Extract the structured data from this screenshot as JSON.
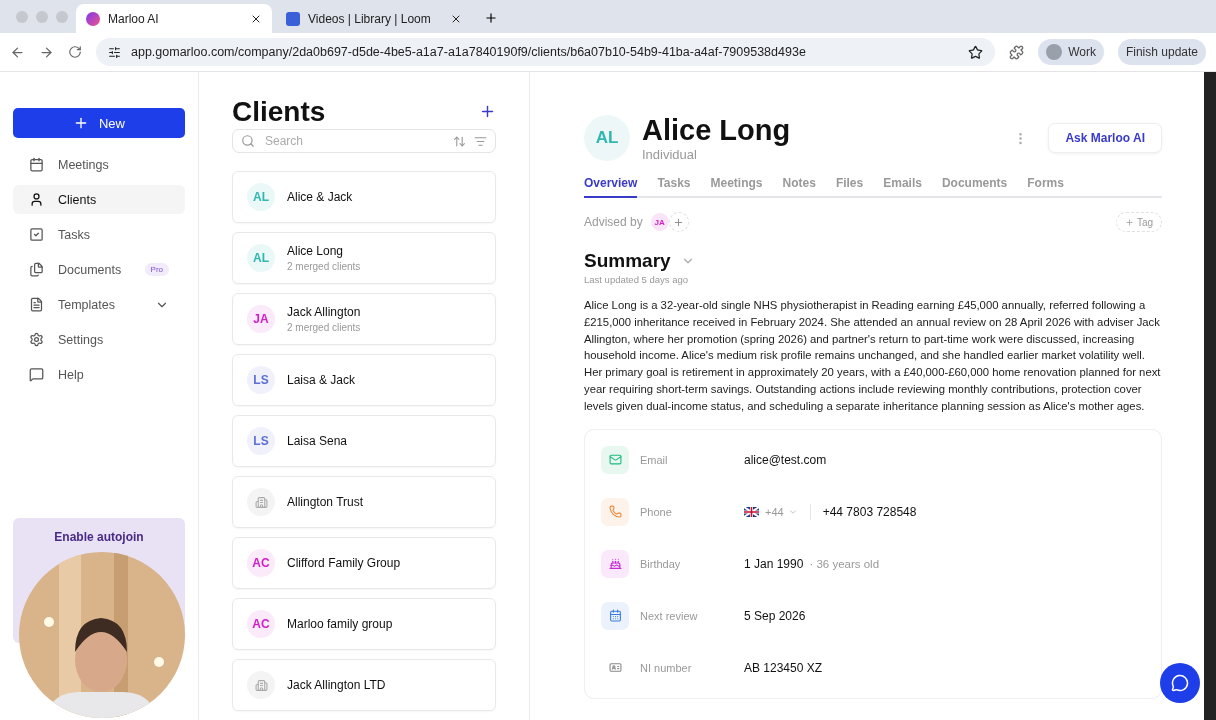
{
  "browser": {
    "tabs": [
      {
        "title": "Marloo AI",
        "selected": true,
        "kind": "marloo"
      },
      {
        "title": "Videos | Library | Loom",
        "selected": false,
        "kind": "loom"
      }
    ],
    "url": "app.gomarloo.com/company/2da0b697-d5de-4be5-a1a7-a1a7840190f9/clients/b6a07b10-54b9-41ba-a4af-7909538d493e",
    "profile": "Work",
    "update": "Finish update"
  },
  "sidebar": {
    "new_button": "New",
    "items": [
      {
        "label": "Meetings",
        "selected": false
      },
      {
        "label": "Clients",
        "selected": true
      },
      {
        "label": "Tasks",
        "selected": false
      },
      {
        "label": "Documents",
        "selected": false,
        "badge": "Pro"
      },
      {
        "label": "Templates",
        "selected": false,
        "expandable": true
      },
      {
        "label": "Settings",
        "selected": false
      },
      {
        "label": "Help",
        "selected": false
      }
    ],
    "promo": {
      "title": "Enable autojoin",
      "kind": "picture"
    }
  },
  "clients": {
    "title": "Clients",
    "search": {
      "placeholder": "Search"
    },
    "items": [
      {
        "kind": "person",
        "initials": "AL",
        "color": "#2fb7b0",
        "name": "Alice & Jack"
      },
      {
        "kind": "person",
        "initials": "AL",
        "color": "#2fb7b0",
        "name": "Alice Long",
        "sub": "2 merged clients"
      },
      {
        "kind": "person",
        "initials": "JA",
        "color": "#d21fc4",
        "name": "Jack Allington",
        "sub": "2 merged clients"
      },
      {
        "kind": "person",
        "initials": "LS",
        "color": "#5b6fd6",
        "name": "Laisa & Jack"
      },
      {
        "kind": "person",
        "initials": "LS",
        "color": "#5b6fd6",
        "name": "Laisa Sena"
      },
      {
        "kind": "trust",
        "name": "Allington Trust"
      },
      {
        "kind": "person",
        "initials": "AC",
        "color": "#d21fc4",
        "name": "Clifford Family Group"
      },
      {
        "kind": "person",
        "initials": "AC",
        "color": "#d21fc4",
        "name": "Marloo family group"
      },
      {
        "kind": "trust",
        "name": "Jack Allington LTD"
      }
    ]
  },
  "detail": {
    "initials": "AL",
    "name": "Alice Long",
    "type": "Individual",
    "ask_button": "Ask Marloo AI",
    "tabs": [
      {
        "label": "Overview",
        "selected": true
      },
      {
        "label": "Tasks",
        "selected": false
      },
      {
        "label": "Meetings",
        "selected": false
      },
      {
        "label": "Notes",
        "selected": false
      },
      {
        "label": "Files",
        "selected": false
      },
      {
        "label": "Emails",
        "selected": false
      },
      {
        "label": "Documents",
        "selected": false
      },
      {
        "label": "Forms",
        "selected": false
      }
    ],
    "advised_by": "Advised by",
    "adviser_initials": "JA",
    "tag_button": "Tag",
    "summary": {
      "title": "Summary",
      "updated": "Last updated 5 days ago",
      "text": "Alice Long is a 32-year-old single NHS physiotherapist in Reading earning £45,000 annually, referred following a £215,000 inheritance received in February 2024. She attended an annual review on 28 April 2026 with adviser Jack Allington, where her promotion (spring 2026) and partner's return to part-time work were discussed, increasing household income. Alice's medium risk profile remains unchanged, and she handled earlier market volatility well. Her primary goal is retirement in approximately 20 years, with a £40,000-£60,000 home renovation planned for next year requiring short-term savings. Outstanding actions include reviewing monthly contributions, protection cover levels given dual-income status, and scheduling a separate inheritance planning session as Alice's mother ages."
    },
    "fields": [
      {
        "kind": "email",
        "label": "Email",
        "value": "alice@test.com"
      },
      {
        "kind": "phone",
        "label": "Phone",
        "code": "+44",
        "value": "+44 7803 728548"
      },
      {
        "kind": "birthday",
        "label": "Birthday",
        "value": "1 Jan 1990",
        "note": "· 36 years old"
      },
      {
        "kind": "review",
        "label": "Next review",
        "value": "5 Sep 2026"
      },
      {
        "kind": "id",
        "label": "NI number",
        "value": "AB 123450 XZ"
      }
    ]
  }
}
